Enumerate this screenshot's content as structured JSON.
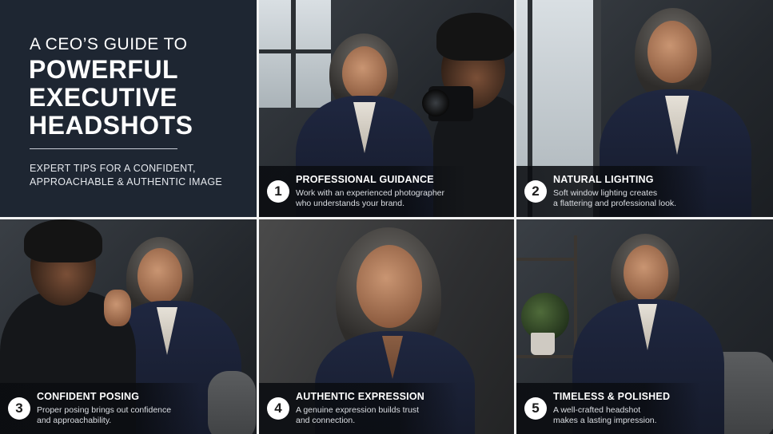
{
  "title": {
    "line1": "A CEO’S GUIDE TO",
    "line2": "POWERFUL",
    "line3": "EXECUTIVE",
    "line4": "HEADSHOTS"
  },
  "subtitle": {
    "line1": "EXPERT TIPS FOR A CONFIDENT,",
    "line2": "APPROACHABLE & AUTHENTIC IMAGE"
  },
  "tips": [
    {
      "number": "1",
      "title": "PROFESSIONAL GUIDANCE",
      "description": "Work with an experienced photographer\nwho understands your brand."
    },
    {
      "number": "2",
      "title": "NATURAL LIGHTING",
      "description": "Soft window lighting creates\na flattering and professional look."
    },
    {
      "number": "3",
      "title": "CONFIDENT POSING",
      "description": "Proper posing brings out confidence\nand approachability."
    },
    {
      "number": "4",
      "title": "AUTHENTIC EXPRESSION",
      "description": "A genuine expression builds trust\nand connection."
    },
    {
      "number": "5",
      "title": "TIMELESS & POLISHED",
      "description": "A well-crafted headshot\nmakes a lasting impression."
    }
  ],
  "colors": {
    "title_panel_bg": "#1e2632",
    "suit": "#1f2740",
    "caption_bg": "#0a0c10"
  }
}
